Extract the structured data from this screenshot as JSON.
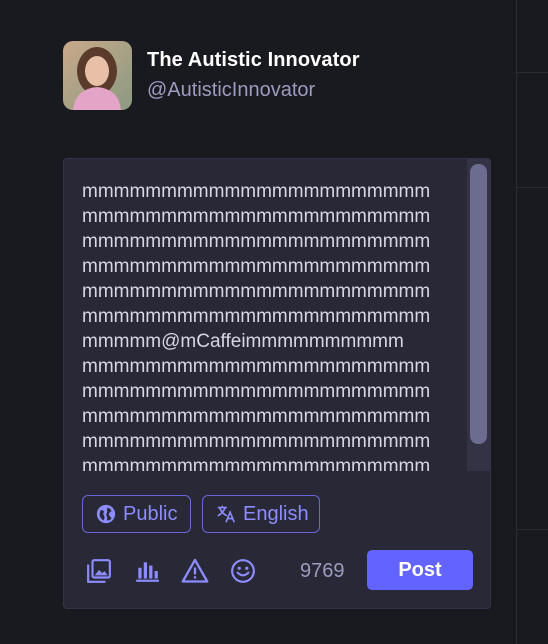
{
  "profile": {
    "display_name": "The Autistic Innovator",
    "handle": "@AutisticInnovator"
  },
  "compose": {
    "text": "mmmmmmmmmmmmmmmmmmmmmm\nmmmmmmmmmmmmmmmmmmmmmm\nmmmmmmmmmmmmmmmmmmmmmm\nmmmmmmmmmmmmmmmmmmmmmm\nmmmmmmmmmmmmmmmmmmmmmm\nmmmmmmmmmmmmmmmmmmmmmm\nmmmmm@mCaffeimmmmmmmmmm\nmmmmmmmmmmmmmmmmmmmmmm\nmmmmmmmmmmmmmmmmmmmmmm\nmmmmmmmmmmmmmmmmmmmmmm\nmmmmmmmmmmmmmmmmmmmmmm\nmmmmmmmmmmmmmmmmmmmmmm",
    "visibility_label": "Public",
    "language_label": "English",
    "char_count": "9769",
    "post_label": "Post"
  },
  "colors": {
    "background": "#191920",
    "panel": "#282836",
    "accent": "#6364ff",
    "muted_text": "#9c9cbf"
  },
  "icons": [
    "globe-icon",
    "translate-icon",
    "media-icon",
    "poll-icon",
    "warning-icon",
    "emoji-icon"
  ]
}
